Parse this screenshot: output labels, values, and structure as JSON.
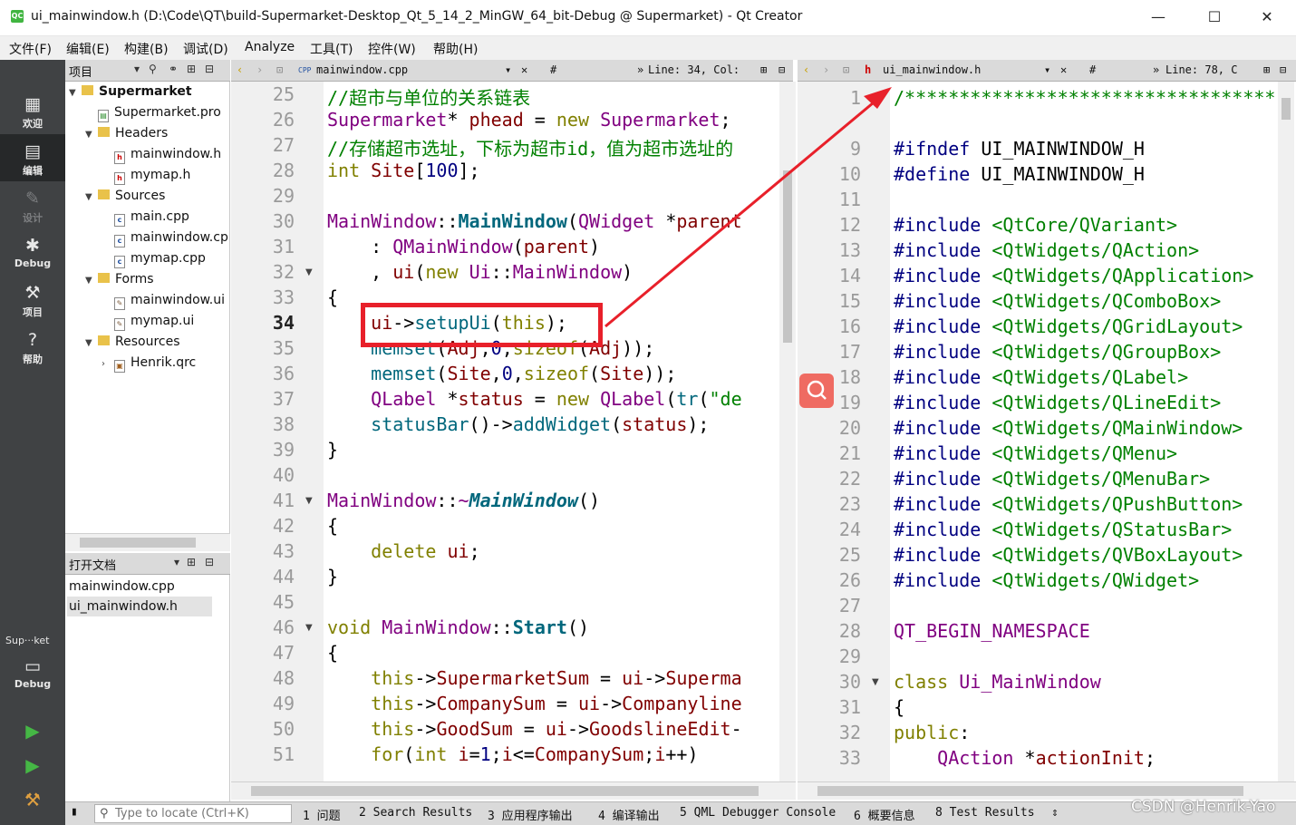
{
  "window": {
    "title": "ui_mainwindow.h (D:\\Code\\QT\\build-Supermarket-Desktop_Qt_5_14_2_MinGW_64_bit-Debug @ Supermarket) - Qt Creator",
    "app_icon_text": "QC",
    "minimize": "—",
    "maximize": "☐",
    "close": "✕"
  },
  "menu": [
    "文件(F)",
    "编辑(E)",
    "构建(B)",
    "调试(D)",
    "Analyze",
    "工具(T)",
    "控件(W)",
    "帮助(H)"
  ],
  "modes": [
    {
      "label": "欢迎",
      "icon": "grid-icon"
    },
    {
      "label": "编辑",
      "icon": "edit-icon"
    },
    {
      "label": "设计",
      "icon": "pencil-icon"
    },
    {
      "label": "Debug",
      "icon": "bug-icon"
    },
    {
      "label": "项目",
      "icon": "wrench-icon"
    },
    {
      "label": "帮助",
      "icon": "help-icon"
    }
  ],
  "kit": {
    "label": "Sup···ket",
    "mode": "Debug"
  },
  "project_pane": {
    "title": "项目",
    "tree": [
      {
        "label": "Supermarket",
        "depth": 0,
        "type": "project",
        "expander": "▼"
      },
      {
        "label": "Supermarket.pro",
        "depth": 1,
        "type": "file",
        "expander": ""
      },
      {
        "label": "Headers",
        "depth": 1,
        "type": "folder",
        "expander": "▼"
      },
      {
        "label": "mainwindow.h",
        "depth": 2,
        "type": "h",
        "expander": ""
      },
      {
        "label": "mymap.h",
        "depth": 2,
        "type": "h",
        "expander": ""
      },
      {
        "label": "Sources",
        "depth": 1,
        "type": "folder",
        "expander": "▼"
      },
      {
        "label": "main.cpp",
        "depth": 2,
        "type": "cpp",
        "expander": ""
      },
      {
        "label": "mainwindow.cpp",
        "depth": 2,
        "type": "cpp",
        "expander": ""
      },
      {
        "label": "mymap.cpp",
        "depth": 2,
        "type": "cpp",
        "expander": ""
      },
      {
        "label": "Forms",
        "depth": 1,
        "type": "folder",
        "expander": "▼"
      },
      {
        "label": "mainwindow.ui",
        "depth": 2,
        "type": "ui",
        "expander": ""
      },
      {
        "label": "mymap.ui",
        "depth": 2,
        "type": "ui",
        "expander": ""
      },
      {
        "label": "Resources",
        "depth": 1,
        "type": "folder",
        "expander": "▼"
      },
      {
        "label": "Henrik.qrc",
        "depth": 2,
        "type": "qrc",
        "expander": "›"
      }
    ]
  },
  "open_docs": {
    "title": "打开文档",
    "items": [
      "mainwindow.cpp",
      "ui_mainwindow.h"
    ],
    "selected": 1
  },
  "left_editor": {
    "file": "mainwindow.cpp",
    "hash": "#",
    "position": "Line: 34, Col:",
    "current_line": 34,
    "lines": [
      {
        "n": 25,
        "fold": "",
        "code": "//超市与单位的关系链表"
      },
      {
        "n": 26,
        "fold": "",
        "code": "Supermarket* phead = new Supermarket;"
      },
      {
        "n": 27,
        "fold": "",
        "code": "//存储超市选址，下标为超市id，值为超市选址的"
      },
      {
        "n": 28,
        "fold": "",
        "code": "int Site[100];"
      },
      {
        "n": 29,
        "fold": "",
        "code": ""
      },
      {
        "n": 30,
        "fold": "",
        "code": "MainWindow::MainWindow(QWidget *parent"
      },
      {
        "n": 31,
        "fold": "",
        "code": "    : QMainWindow(parent)"
      },
      {
        "n": 32,
        "fold": "▼",
        "code": "    , ui(new Ui::MainWindow)"
      },
      {
        "n": 33,
        "fold": "",
        "code": "{"
      },
      {
        "n": 34,
        "fold": "",
        "code": "    ui->setupUi(this);"
      },
      {
        "n": 35,
        "fold": "",
        "code": "    memset(Adj,0,sizeof(Adj));"
      },
      {
        "n": 36,
        "fold": "",
        "code": "    memset(Site,0,sizeof(Site));"
      },
      {
        "n": 37,
        "fold": "",
        "code": "    QLabel *status = new QLabel(tr(\"de"
      },
      {
        "n": 38,
        "fold": "",
        "code": "    statusBar()->addWidget(status);"
      },
      {
        "n": 39,
        "fold": "",
        "code": "}"
      },
      {
        "n": 40,
        "fold": "",
        "code": ""
      },
      {
        "n": 41,
        "fold": "▼",
        "code": "MainWindow::~MainWindow()"
      },
      {
        "n": 42,
        "fold": "",
        "code": "{"
      },
      {
        "n": 43,
        "fold": "",
        "code": "    delete ui;"
      },
      {
        "n": 44,
        "fold": "",
        "code": "}"
      },
      {
        "n": 45,
        "fold": "",
        "code": ""
      },
      {
        "n": 46,
        "fold": "▼",
        "code": "void MainWindow::Start()"
      },
      {
        "n": 47,
        "fold": "",
        "code": "{"
      },
      {
        "n": 48,
        "fold": "",
        "code": "    this->SupermarketSum = ui->Superma"
      },
      {
        "n": 49,
        "fold": "",
        "code": "    this->CompanySum = ui->Companyline"
      },
      {
        "n": 50,
        "fold": "",
        "code": "    this->GoodSum = ui->GoodslineEdit-"
      },
      {
        "n": 51,
        "fold": "",
        "code": "    for(int i=1;i<=CompanySum;i++)"
      }
    ]
  },
  "right_editor": {
    "file": "ui_mainwindow.h",
    "hash": "#",
    "position": "Line: 78, C",
    "lines": [
      {
        "n": 1,
        "fold": "",
        "code": "/**********************************"
      },
      {
        "n": "",
        "fold": "",
        "code": ""
      },
      {
        "n": 9,
        "fold": "",
        "code": "#ifndef UI_MAINWINDOW_H"
      },
      {
        "n": 10,
        "fold": "",
        "code": "#define UI_MAINWINDOW_H"
      },
      {
        "n": 11,
        "fold": "",
        "code": ""
      },
      {
        "n": 12,
        "fold": "",
        "code": "#include <QtCore/QVariant>"
      },
      {
        "n": 13,
        "fold": "",
        "code": "#include <QtWidgets/QAction>"
      },
      {
        "n": 14,
        "fold": "",
        "code": "#include <QtWidgets/QApplication>"
      },
      {
        "n": 15,
        "fold": "",
        "code": "#include <QtWidgets/QComboBox>"
      },
      {
        "n": 16,
        "fold": "",
        "code": "#include <QtWidgets/QGridLayout>"
      },
      {
        "n": 17,
        "fold": "",
        "code": "#include <QtWidgets/QGroupBox>"
      },
      {
        "n": 18,
        "fold": "",
        "code": "#include <QtWidgets/QLabel>"
      },
      {
        "n": 19,
        "fold": "",
        "code": "#include <QtWidgets/QLineEdit>"
      },
      {
        "n": 20,
        "fold": "",
        "code": "#include <QtWidgets/QMainWindow>"
      },
      {
        "n": 21,
        "fold": "",
        "code": "#include <QtWidgets/QMenu>"
      },
      {
        "n": 22,
        "fold": "",
        "code": "#include <QtWidgets/QMenuBar>"
      },
      {
        "n": 23,
        "fold": "",
        "code": "#include <QtWidgets/QPushButton>"
      },
      {
        "n": 24,
        "fold": "",
        "code": "#include <QtWidgets/QStatusBar>"
      },
      {
        "n": 25,
        "fold": "",
        "code": "#include <QtWidgets/QVBoxLayout>"
      },
      {
        "n": 26,
        "fold": "",
        "code": "#include <QtWidgets/QWidget>"
      },
      {
        "n": 27,
        "fold": "",
        "code": ""
      },
      {
        "n": 28,
        "fold": "",
        "code": "QT_BEGIN_NAMESPACE"
      },
      {
        "n": 29,
        "fold": "",
        "code": ""
      },
      {
        "n": 30,
        "fold": "▼",
        "code": "class Ui_MainWindow"
      },
      {
        "n": 31,
        "fold": "",
        "code": "{"
      },
      {
        "n": 32,
        "fold": "",
        "code": "public:"
      },
      {
        "n": 33,
        "fold": "",
        "code": "    QAction *actionInit;"
      }
    ]
  },
  "locator": {
    "placeholder": "Type to locate (Ctrl+K)"
  },
  "output_tabs": [
    "1 问题",
    "2 Search Results",
    "3 应用程序输出",
    "4 编译输出",
    "5 QML Debugger Console",
    "6 概要信息",
    "8 Test Results",
    "⇕"
  ],
  "watermark": "CSDN @Henrik-Yao",
  "colors": {
    "accent": "#e8202a",
    "modebar": "#404244",
    "comment": "#008000",
    "keyword": "#808000",
    "type": "#800080"
  }
}
